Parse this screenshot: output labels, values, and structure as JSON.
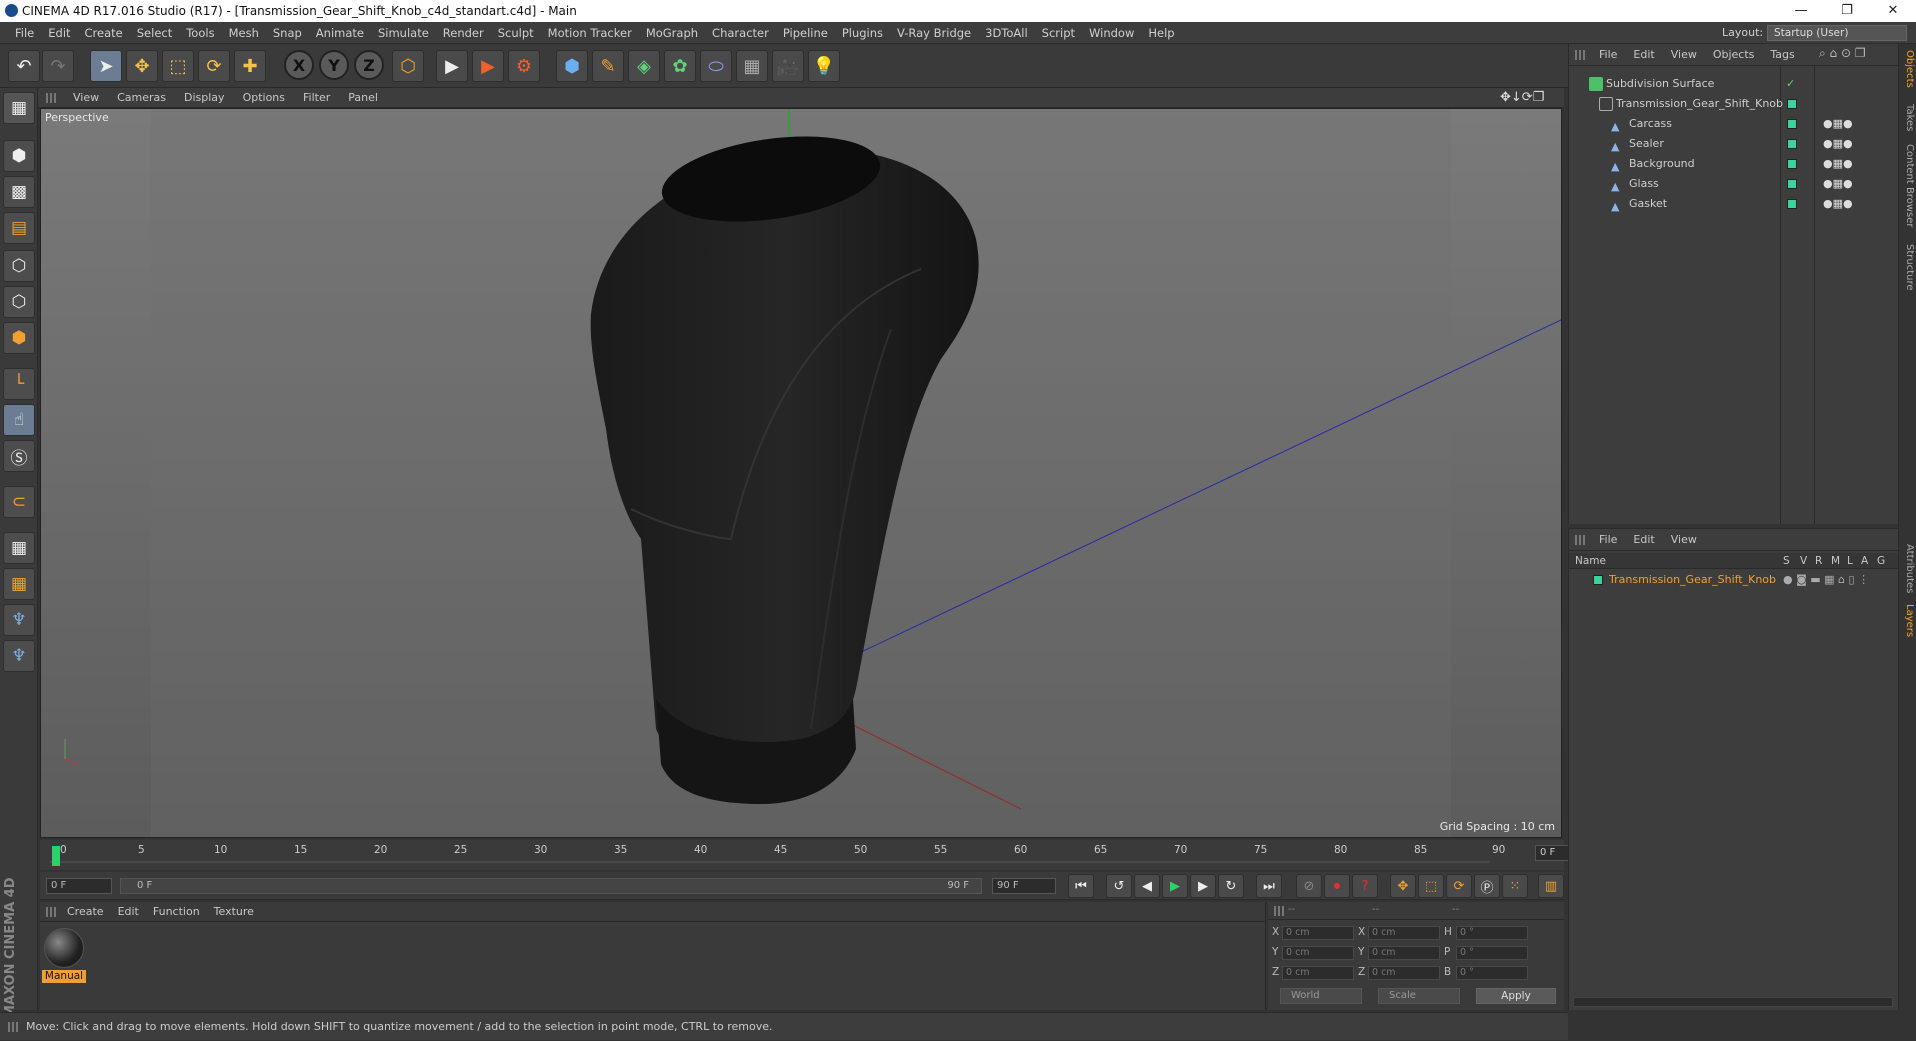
{
  "window": {
    "title": "CINEMA 4D R17.016 Studio (R17) - [Transmission_Gear_Shift_Knob_c4d_standart.c4d] - Main",
    "min": "—",
    "max": "❐",
    "close": "✕"
  },
  "menu": [
    "File",
    "Edit",
    "Create",
    "Select",
    "Tools",
    "Mesh",
    "Snap",
    "Animate",
    "Simulate",
    "Render",
    "Sculpt",
    "Motion Tracker",
    "MoGraph",
    "Character",
    "Pipeline",
    "Plugins",
    "V-Ray Bridge",
    "3DToAll",
    "Script",
    "Window",
    "Help"
  ],
  "layout": {
    "label": "Layout:",
    "value": "Startup (User)"
  },
  "toolbar": {
    "undo": "↶",
    "redo": "↷",
    "select": "➤",
    "move": "✥",
    "scale": "⬚",
    "rotate": "⟳",
    "last": "✚",
    "x": "X",
    "y": "Y",
    "z": "Z",
    "coord": "⬡",
    "render_view": "▶",
    "render_pic": "▶",
    "render_settings": "⚙",
    "cube": "⬢",
    "pen": "✎",
    "subdiv": "◈",
    "cloner": "✿",
    "deformer": "⬭",
    "floor": "▦",
    "camera": "🎥",
    "light": "💡"
  },
  "viewport": {
    "menu": [
      "View",
      "Cameras",
      "Display",
      "Options",
      "Filter",
      "Panel"
    ],
    "label": "Perspective",
    "grid_spacing": "Grid Spacing : 10 cm",
    "nav": "✥↓⟳❐"
  },
  "timeline": {
    "ticks": [
      "0",
      "5",
      "10",
      "15",
      "20",
      "25",
      "30",
      "35",
      "40",
      "45",
      "50",
      "55",
      "60",
      "65",
      "70",
      "75",
      "80",
      "85",
      "90"
    ],
    "frame": "0 F",
    "start": "0 F",
    "range_start": "0 F",
    "range_end": "90 F",
    "end": "90 F"
  },
  "transport": {
    "first": "⏮",
    "prev_key": "↺",
    "prev": "◀",
    "play": "▶",
    "next": "▶",
    "next_key": "↻",
    "last": "⏭"
  },
  "materials": {
    "menu": [
      "Create",
      "Edit",
      "Function",
      "Texture"
    ],
    "item": "Manual"
  },
  "coordinates": {
    "header": [
      "--",
      "--",
      "--"
    ],
    "rows": [
      {
        "a": "X",
        "av": "0 cm",
        "b": "X",
        "bv": "0 cm",
        "c": "H",
        "cv": "0 °"
      },
      {
        "a": "Y",
        "av": "0 cm",
        "b": "Y",
        "bv": "0 cm",
        "c": "P",
        "cv": "0 °"
      },
      {
        "a": "Z",
        "av": "0 cm",
        "b": "Z",
        "bv": "0 cm",
        "c": "B",
        "cv": "0 °"
      }
    ],
    "space": "World",
    "mode": "Scale",
    "apply": "Apply"
  },
  "status": "Move: Click and drag to move elements. Hold down SHIFT to quantize movement / add to the selection in point mode, CTRL to remove.",
  "objects": {
    "menu": [
      "File",
      "Edit",
      "View",
      "Objects",
      "Tags"
    ],
    "items": [
      "Subdivision Surface",
      "Transmission_Gear_Shift_Knob",
      "Carcass",
      "Sealer",
      "Background",
      "Glass",
      "Gasket"
    ]
  },
  "attributes": {
    "menu": [
      "File",
      "Edit",
      "View"
    ],
    "columns": [
      "Name",
      "S",
      "V",
      "R",
      "M",
      "L",
      "A",
      "G"
    ],
    "layer": "Transmission_Gear_Shift_Knob"
  },
  "sidetabs": [
    "Objects",
    "Takes",
    "Content Browser",
    "Structure",
    "Attributes",
    "Layers"
  ],
  "logo": "MAXON CINEMA 4D",
  "colors": {
    "accent": "#f0a030",
    "layer_green": "#3cd29a"
  }
}
